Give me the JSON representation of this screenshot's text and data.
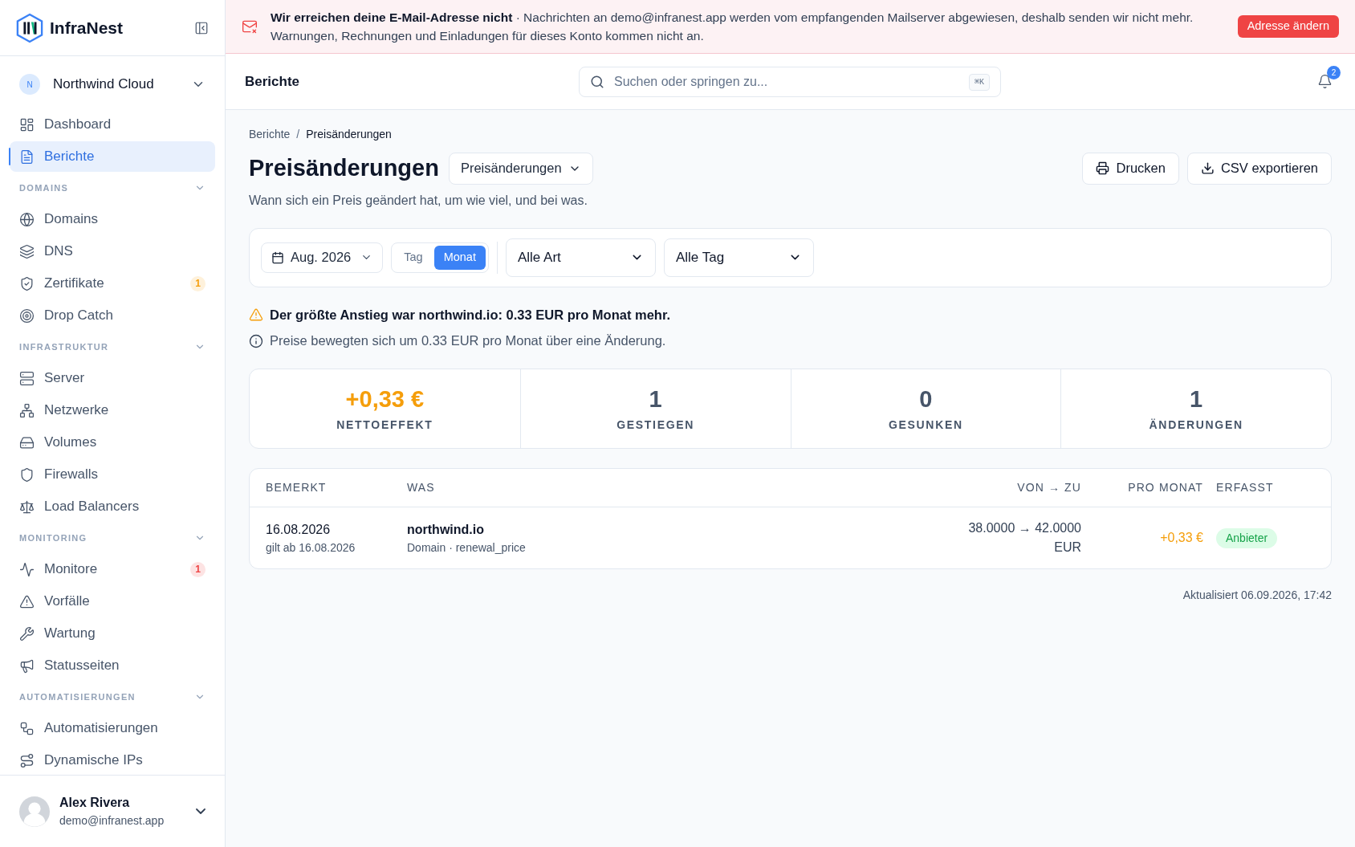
{
  "sidebar": {
    "brand": "InfraNest",
    "workspace": {
      "initial": "N",
      "name": "Northwind Cloud"
    },
    "items": [
      {
        "label": "Dashboard",
        "selected": false
      },
      {
        "label": "Berichte",
        "selected": true
      }
    ],
    "sections": [
      {
        "title": "DOMAINS",
        "expanded": true,
        "items": [
          {
            "label": "Domains",
            "selected": false
          },
          {
            "label": "DNS",
            "selected": false
          },
          {
            "label": "Zertifikate",
            "selected": false,
            "badge": {
              "text": "1",
              "color": "#f59e0b"
            }
          },
          {
            "label": "Drop Catch",
            "selected": false
          }
        ]
      },
      {
        "title": "INFRASTRUKTUR",
        "expanded": true,
        "items": [
          {
            "label": "Server",
            "selected": false
          },
          {
            "label": "Netzwerke",
            "selected": false
          },
          {
            "label": "Volumes",
            "selected": false
          },
          {
            "label": "Firewalls",
            "selected": false
          },
          {
            "label": "Load Balancers",
            "selected": false
          }
        ]
      },
      {
        "title": "MONITORING",
        "expanded": true,
        "items": [
          {
            "label": "Monitore",
            "selected": false,
            "badge": {
              "text": "1",
              "color": "#ef4444"
            }
          },
          {
            "label": "Vorfälle",
            "selected": false
          },
          {
            "label": "Wartung",
            "selected": false
          },
          {
            "label": "Statusseiten",
            "selected": false
          }
        ]
      },
      {
        "title": "AUTOMATISIERUNGEN",
        "expanded": true,
        "items": [
          {
            "label": "Automatisierungen",
            "selected": false
          },
          {
            "label": "Dynamische IPs",
            "selected": false
          }
        ]
      }
    ],
    "user": {
      "name": "Alex Rivera",
      "email": "demo@infranest.app"
    }
  },
  "banner": {
    "text": "**Wir erreichen deine E-Mail-Adresse nicht** · Nachrichten an demo@infranest.app werden vom empfangenden Mailserver abgewiesen, deshalb senden wir nicht mehr. Warnungen, Rechnungen und Einladungen für dieses Konto kommen nicht an.",
    "button": "Adresse ändern"
  },
  "header": {
    "title": "Berichte",
    "search": {
      "placeholder": "Suchen oder springen zu...",
      "shortcut": "⌘K"
    },
    "notifications": "2"
  },
  "breadcrumb": {
    "items": [
      "Berichte",
      "Preisänderungen"
    ],
    "separator": "/"
  },
  "page": {
    "title": "Preisänderungen",
    "report_select": "Preisänderungen",
    "subtitle": "Wann sich ein Preis geändert hat, um wie viel, und bei was.",
    "actions": [
      "Drucken",
      "CSV exportieren"
    ]
  },
  "filters": {
    "period": "Aug. 2026",
    "granularity": [
      {
        "label": "Tag",
        "selected": false
      },
      {
        "label": "Monat",
        "selected": true
      }
    ],
    "selects": [
      "Alle Art",
      "Alle Tag"
    ]
  },
  "notices": [
    {
      "kind": "warning",
      "text": "Der größte Anstieg war northwind.io: 0.33 EUR pro Monat mehr."
    },
    {
      "kind": "info",
      "text": "Preise bewegten sich um 0.33 EUR pro Monat über eine Änderung."
    }
  ],
  "stats": [
    {
      "value": "+0,33 €",
      "label": "NETTOEFFEKT",
      "color": "#f59e0b"
    },
    {
      "value": "1",
      "label": "GESTIEGEN",
      "color": "#475569"
    },
    {
      "value": "0",
      "label": "GESUNKEN",
      "color": "#475569"
    },
    {
      "value": "1",
      "label": "ÄNDERUNGEN",
      "color": "#475569"
    }
  ],
  "table": {
    "columns": [
      "BEMERKT",
      "WAS",
      "VON → ZU",
      "PRO MONAT",
      "ERFASST"
    ],
    "rows": [
      {
        "date": "16.08.2026",
        "effective": "gilt ab 16.08.2026",
        "name": "northwind.io",
        "detail": "Domain · renewal_price",
        "change": [
          "38.0000 → 42.0000",
          "EUR"
        ],
        "monthly": "+0,33 €",
        "source": "Anbieter"
      }
    ]
  },
  "updated": "Aktualisiert 06.09.2026, 17:42"
}
